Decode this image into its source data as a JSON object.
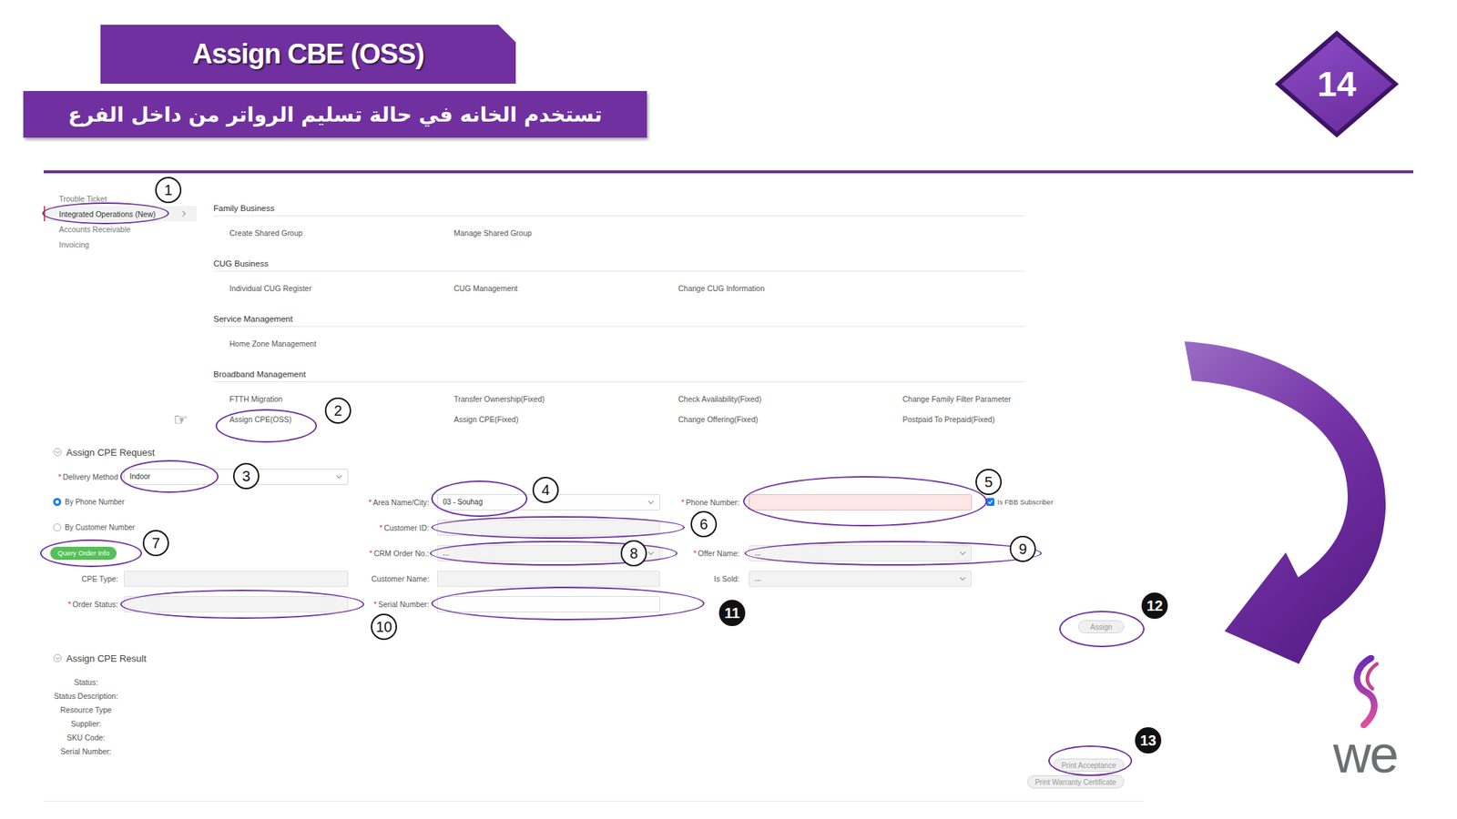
{
  "slide": {
    "title": "Assign CBE (OSS)",
    "subtitle": "تستخدم الخانه في حالة تسليم الرواتر من داخل الفرع",
    "page_number": "14"
  },
  "sidebar": {
    "items": [
      {
        "label": "Trouble Ticket",
        "selected": false
      },
      {
        "label": "Integrated Operations (New)",
        "selected": true
      },
      {
        "label": "Accounts Receivable",
        "selected": false
      },
      {
        "label": "Invoicing",
        "selected": false
      }
    ]
  },
  "menu": {
    "sections": [
      {
        "title": "Family Business",
        "items": [
          "Create Shared Group",
          "Manage Shared Group"
        ]
      },
      {
        "title": "CUG Business",
        "items": [
          "Individual CUG Register",
          "CUG Management",
          "Change CUG Information"
        ]
      },
      {
        "title": "Service Management",
        "items": [
          "Home Zone Management"
        ]
      },
      {
        "title": "Broadband Management",
        "items": [
          "FTTH Migration",
          "Transfer Ownership(Fixed)",
          "Check Availability(Fixed)",
          "Change Family Filter Parameter",
          "Assign CPE(OSS)",
          "Assign CPE(Fixed)",
          "Change Offering(Fixed)",
          "Postpaid To Prepaid(Fixed)"
        ]
      }
    ]
  },
  "form": {
    "title": "Assign CPE Request",
    "required_mark": "*",
    "fields": [
      {
        "label": "Delivery Method",
        "required": true,
        "kind": "select",
        "value": "Indoor",
        "disabled": false,
        "error": false
      },
      {
        "label": "Area Name/City:",
        "required": true,
        "kind": "select",
        "value": "03 - Souhag",
        "disabled": false,
        "error": false
      },
      {
        "label": "Phone Number:",
        "required": true,
        "kind": "input",
        "value": "",
        "disabled": false,
        "error": true
      },
      {
        "label": "Customer ID:",
        "required": true,
        "kind": "input",
        "value": "",
        "disabled": true,
        "error": false
      },
      {
        "label": "CRM Order No.:",
        "required": true,
        "kind": "select",
        "value": "...",
        "disabled": true,
        "error": false
      },
      {
        "label": "Offer Name:",
        "required": true,
        "kind": "select",
        "value": "...",
        "disabled": true,
        "error": false
      },
      {
        "label": "CPE Type:",
        "required": false,
        "kind": "input",
        "value": "",
        "disabled": true,
        "error": false
      },
      {
        "label": "Customer Name:",
        "required": false,
        "kind": "input",
        "value": "",
        "disabled": true,
        "error": false
      },
      {
        "label": "Is Sold:",
        "required": false,
        "kind": "select",
        "value": "...",
        "disabled": true,
        "error": false
      },
      {
        "label": "Order Status:",
        "required": true,
        "kind": "input",
        "value": "",
        "disabled": true,
        "error": false
      },
      {
        "label": "Serial Number:",
        "required": true,
        "kind": "input",
        "value": "",
        "disabled": false,
        "error": false
      }
    ],
    "radios": [
      {
        "label": "By Phone Number",
        "selected": true
      },
      {
        "label": "By Customer Number",
        "selected": false
      }
    ],
    "checkbox": {
      "label": "Is FBB Subscriber",
      "checked": true
    },
    "query_button": {
      "label": "Query Order Info"
    },
    "assign_button": {
      "label": "Assign",
      "disabled": true
    }
  },
  "result": {
    "title": "Assign CPE Result",
    "labels": [
      "Status:",
      "Status Description:",
      "Resource Type",
      "Supplier:",
      "SKU Code:",
      "Serial Number:"
    ],
    "buttons": [
      {
        "label": "Print Acceptance",
        "disabled": true
      },
      {
        "label": "Print Warranty Certificate",
        "disabled": true
      }
    ]
  },
  "annotations": {
    "pointer": "☞",
    "markers": [
      {
        "number": "1",
        "filled": false
      },
      {
        "number": "2",
        "filled": false
      },
      {
        "number": "3",
        "filled": false
      },
      {
        "number": "4",
        "filled": false
      },
      {
        "number": "5",
        "filled": false
      },
      {
        "number": "6",
        "filled": false
      },
      {
        "number": "7",
        "filled": false
      },
      {
        "number": "8",
        "filled": false
      },
      {
        "number": "9",
        "filled": false
      },
      {
        "number": "10",
        "filled": false
      },
      {
        "number": "11",
        "filled": true
      },
      {
        "number": "12",
        "filled": true
      },
      {
        "number": "13",
        "filled": true
      }
    ]
  },
  "logo": {
    "text": "we"
  }
}
